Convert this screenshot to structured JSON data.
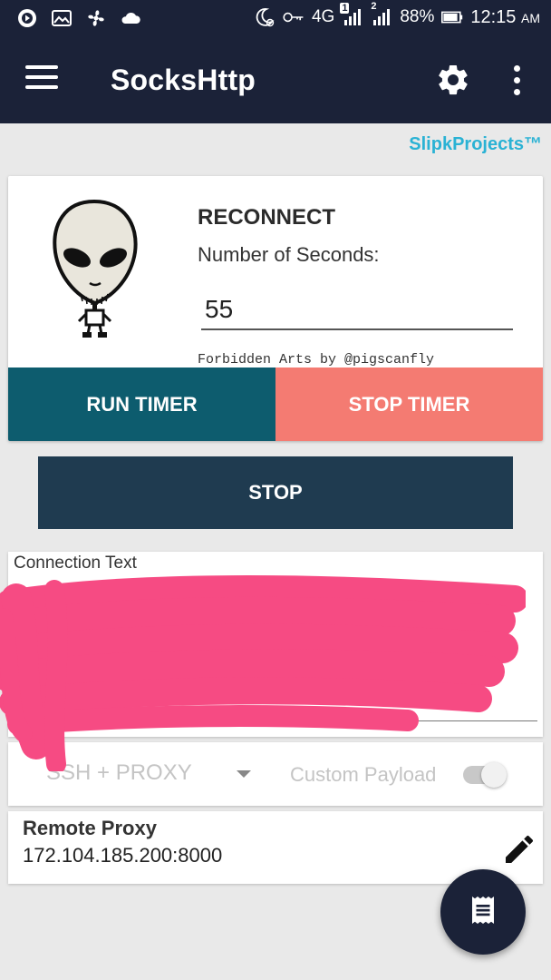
{
  "status_bar": {
    "network": "4G",
    "sim1_badge": "1",
    "sim2_badge": "2",
    "battery": "88%",
    "time": "12:15",
    "ampm": "AM",
    "icons": [
      "media-icon",
      "image-icon",
      "fan-icon",
      "cloud-icon",
      "moon-alarm-icon",
      "key-icon",
      "signal-icon",
      "battery-icon"
    ]
  },
  "app_bar": {
    "title": "SocksHttp",
    "icons": [
      "menu-icon",
      "gear-icon",
      "more-vert-icon"
    ]
  },
  "brand": "SlipkProjects™",
  "reconnect": {
    "title": "RECONNECT",
    "seconds_label": "Number of Seconds:",
    "seconds_value": "55",
    "credit": "Forbidden Arts by @pigscanfly",
    "run_label": "RUN TIMER",
    "stop_label": "STOP TIMER",
    "illustration": "alien-icon"
  },
  "stop_button": "STOP",
  "connection": {
    "label": "Connection Text",
    "value": ""
  },
  "mode": {
    "selected": "SSH + PROXY",
    "payload_label": "Custom Payload",
    "payload_enabled": false
  },
  "remote_proxy": {
    "title": "Remote Proxy",
    "value": "172.104.185.200:8000"
  },
  "fab": {
    "icon": "receipt-log-icon"
  },
  "colors": {
    "app_bar": "#1b2238",
    "brand": "#2ab2d4",
    "run_timer": "#0d5c6e",
    "stop_timer": "#f47b72",
    "stop": "#1f3b50",
    "redaction": "#f64b83"
  }
}
